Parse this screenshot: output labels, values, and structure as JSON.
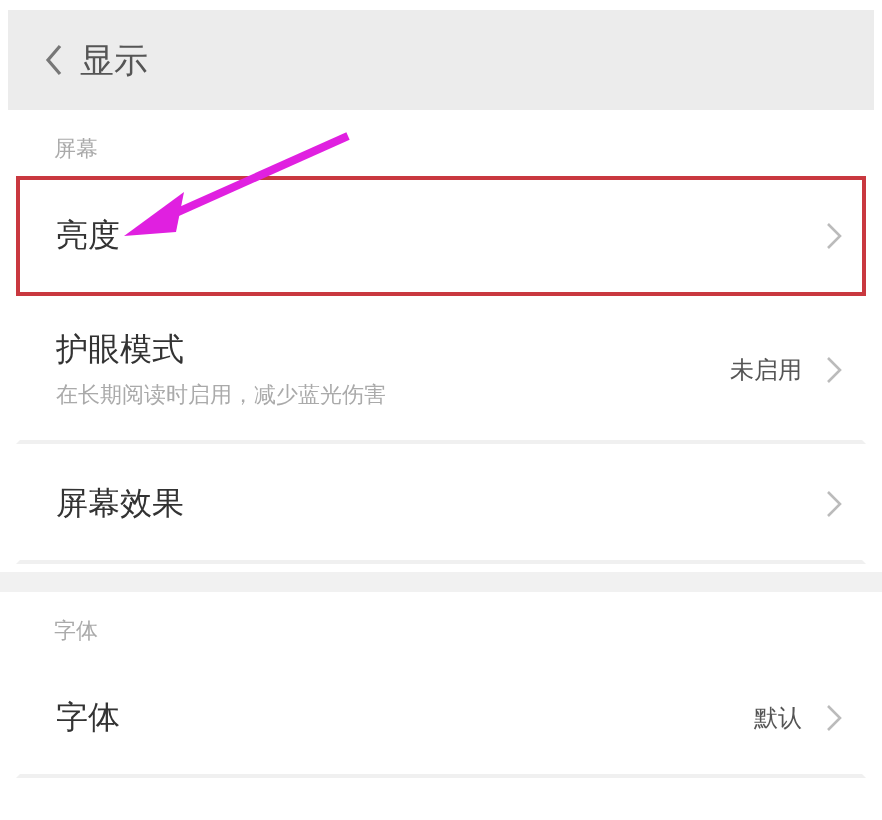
{
  "header": {
    "title": "显示"
  },
  "sections": [
    {
      "label": "屏幕",
      "items": [
        {
          "title": "亮度",
          "highlighted": true
        },
        {
          "title": "护眼模式",
          "subtitle": "在长期阅读时启用，减少蓝光伤害",
          "value": "未启用",
          "highlighted": false
        },
        {
          "title": "屏幕效果",
          "highlighted": false
        }
      ]
    },
    {
      "label": "字体",
      "items": [
        {
          "title": "字体",
          "value": "默认",
          "highlighted": false
        }
      ]
    }
  ]
}
